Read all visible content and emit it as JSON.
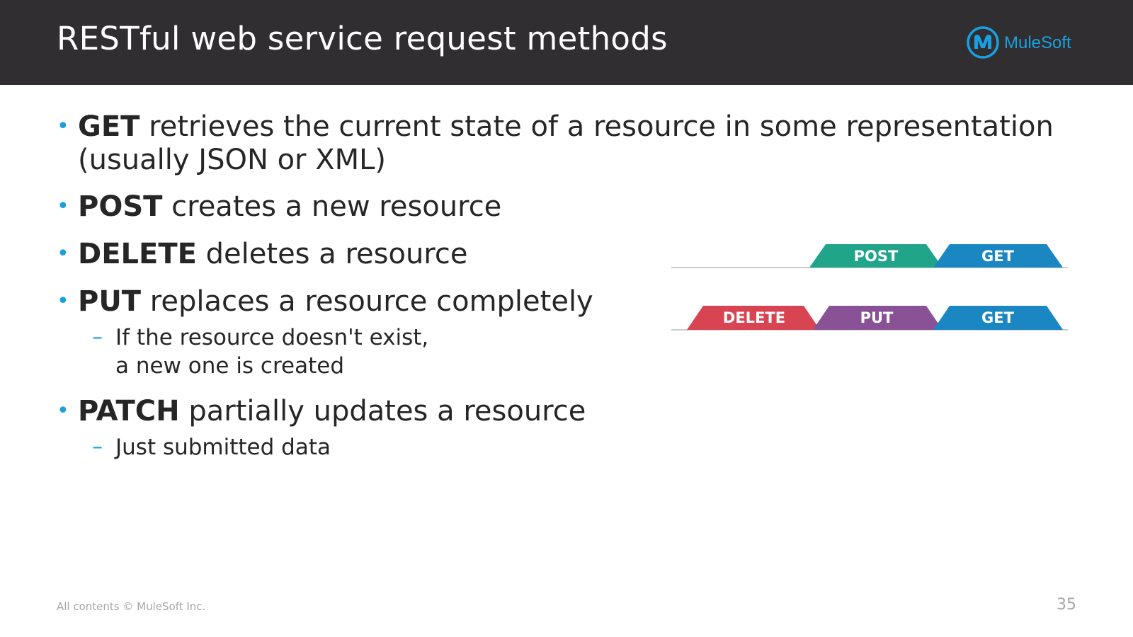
{
  "header": {
    "title": "RESTful web service request methods",
    "logo_text": "MuleSoft"
  },
  "bullets": [
    {
      "method": "GET",
      "line1": " retrieves the current state of a resource in some representation",
      "line2": "(usually JSON or XML)"
    },
    {
      "method": "POST",
      "rest": " creates a new resource"
    },
    {
      "method": "DELETE",
      "rest": " deletes a resource"
    },
    {
      "method": "PUT",
      "rest": " replaces a resource completely",
      "sub": {
        "dash": "–",
        "line1": "If the resource doesn't exist,",
        "line2": "a new one is created"
      }
    },
    {
      "method": "PATCH",
      "rest": " partially updates a resource",
      "sub": {
        "dash": "–",
        "line1": "Just submitted data"
      }
    }
  ],
  "bullet_glyph": "•",
  "diagram": {
    "row1": [
      {
        "label": "POST",
        "color": "#20a58a"
      },
      {
        "label": "GET",
        "color": "#1a87c3"
      }
    ],
    "row2": [
      {
        "label": "DELETE",
        "color": "#d94452"
      },
      {
        "label": "PUT",
        "color": "#8a5296"
      },
      {
        "label": "GET",
        "color": "#1a87c3"
      }
    ],
    "baseline_color": "#cccccc"
  },
  "footer": {
    "copyright": "All contents © MuleSoft Inc.",
    "page_number": "35"
  },
  "colors": {
    "header_bg": "#302e30",
    "accent": "#1aa0e0",
    "logo": "#1aa0e0"
  }
}
